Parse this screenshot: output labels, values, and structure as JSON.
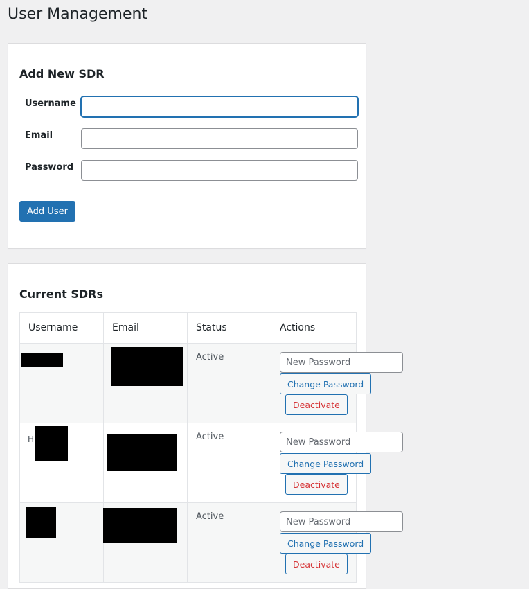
{
  "page": {
    "title": "User Management"
  },
  "add_form": {
    "title": "Add New SDR",
    "username_label": "Username",
    "email_label": "Email",
    "password_label": "Password",
    "username_value": "",
    "email_value": "",
    "password_value": "",
    "submit_label": "Add User"
  },
  "list": {
    "title": "Current SDRs",
    "columns": [
      "Username",
      "Email",
      "Status",
      "Actions"
    ],
    "rows": [
      {
        "status": "Active",
        "new_password_placeholder": "New Password",
        "change_label": "Change Password",
        "deactivate_label": "Deactivate"
      },
      {
        "username_fragment": "H",
        "status": "Active",
        "new_password_placeholder": "New Password",
        "change_label": "Change Password",
        "deactivate_label": "Deactivate"
      },
      {
        "status": "Active",
        "new_password_placeholder": "New Password",
        "change_label": "Change Password",
        "deactivate_label": "Deactivate"
      }
    ]
  },
  "colors": {
    "primary": "#2271b1",
    "danger": "#d63638",
    "background": "#f0f0f1"
  }
}
